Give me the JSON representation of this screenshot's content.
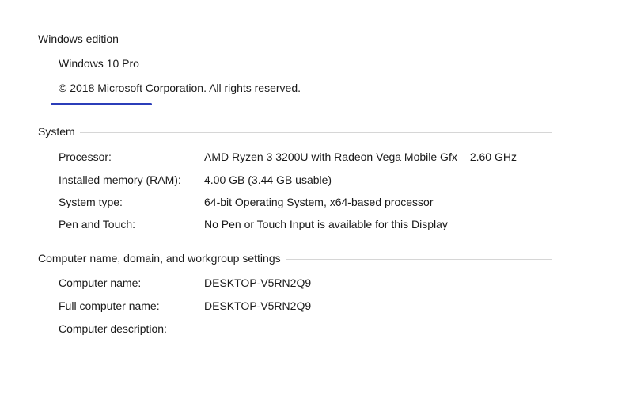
{
  "windows_edition": {
    "heading": "Windows edition",
    "edition": "Windows 10 Pro",
    "copyright": "© 2018 Microsoft Corporation. All rights reserved.",
    "accent_color": "#2b3db9"
  },
  "system": {
    "heading": "System",
    "rows": [
      {
        "label": "Processor:",
        "value": "AMD Ryzen 3 3200U with Radeon Vega Mobile Gfx",
        "extra": "2.60 GHz"
      },
      {
        "label": "Installed memory (RAM):",
        "value": "4.00 GB (3.44 GB usable)"
      },
      {
        "label": "System type:",
        "value": "64-bit Operating System, x64-based processor"
      },
      {
        "label": "Pen and Touch:",
        "value": "No Pen or Touch Input is available for this Display"
      }
    ]
  },
  "computer_settings": {
    "heading": "Computer name, domain, and workgroup settings",
    "rows": [
      {
        "label": "Computer name:",
        "value": "DESKTOP-V5RN2Q9"
      },
      {
        "label": "Full computer name:",
        "value": "DESKTOP-V5RN2Q9"
      },
      {
        "label": "Computer description:",
        "value": ""
      }
    ]
  }
}
